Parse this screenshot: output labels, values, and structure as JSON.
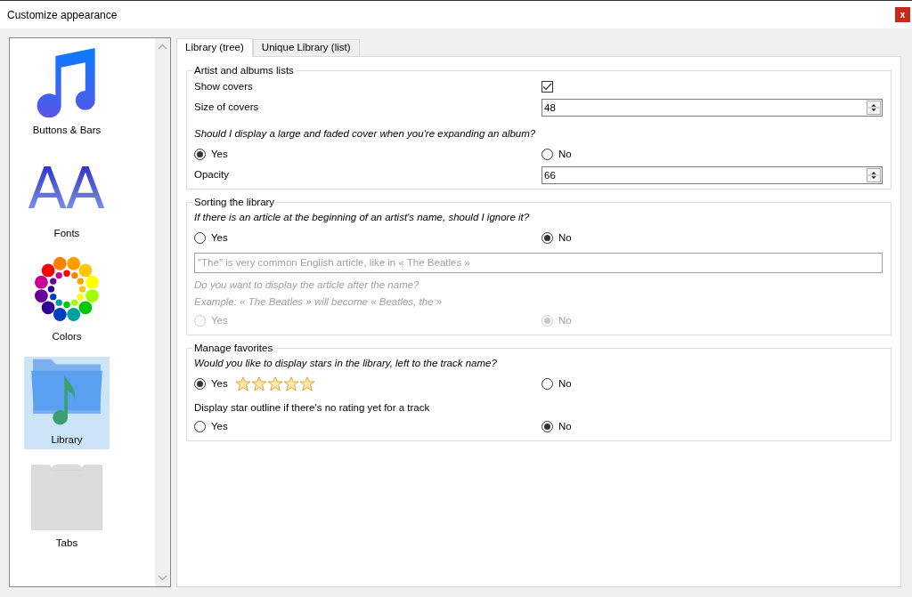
{
  "window": {
    "title": "Customize appearance",
    "close": "x"
  },
  "sidebar": {
    "items": [
      {
        "label": "Buttons & Bars",
        "kind": "note",
        "selected": false
      },
      {
        "label": "Fonts",
        "kind": "letters",
        "glyph": "AA",
        "selected": false
      },
      {
        "label": "Colors",
        "kind": "palette",
        "selected": false
      },
      {
        "label": "Library",
        "kind": "folder",
        "selected": true
      },
      {
        "label": "Tabs",
        "kind": "tabs",
        "selected": false
      }
    ]
  },
  "tabs": [
    {
      "label": "Library (tree)",
      "selected": true
    },
    {
      "label": "Unique Library (list)",
      "selected": false
    }
  ],
  "sections": [
    {
      "title": "Artist and albums lists",
      "rows": [
        {
          "kind": "checkbox",
          "label": "Show covers",
          "checked": true
        },
        {
          "kind": "spinner",
          "label": "Size of covers",
          "value": "48"
        },
        {
          "kind": "question",
          "text": "Should I display a large and faded cover when you're expanding an album?",
          "disabled": false
        },
        {
          "kind": "radios",
          "disabled": false,
          "options": [
            {
              "label": "Yes",
              "selected": true
            },
            {
              "label": "No",
              "selected": false
            }
          ]
        },
        {
          "kind": "spinner",
          "label": "Opacity",
          "value": "66"
        }
      ]
    },
    {
      "title": "Sorting the library",
      "rows": [
        {
          "kind": "question",
          "text": "If there is an article at the beginning of an artist's name, should I ignore it?",
          "disabled": false
        },
        {
          "kind": "radios",
          "disabled": false,
          "options": [
            {
              "label": "Yes",
              "selected": false
            },
            {
              "label": "No",
              "selected": true
            }
          ]
        },
        {
          "kind": "textfield",
          "placeholder": "\"The\" is very common English article, like in « The Beatles »"
        },
        {
          "kind": "question",
          "text": "Do you want to display the article after the name?",
          "disabled": true
        },
        {
          "kind": "question",
          "text": "Example:  « The Beatles » will become « Beatles, the »",
          "disabled": true
        },
        {
          "kind": "radios",
          "disabled": true,
          "options": [
            {
              "label": "Yes",
              "selected": false
            },
            {
              "label": "No",
              "selected": true
            }
          ]
        }
      ]
    },
    {
      "title": "Manage favorites",
      "rows": [
        {
          "kind": "question",
          "text": "Would you like to display stars in the library, left to the track name?",
          "disabled": false
        },
        {
          "kind": "radios",
          "disabled": false,
          "stars": 5,
          "options": [
            {
              "label": "Yes",
              "selected": true
            },
            {
              "label": "No",
              "selected": false
            }
          ]
        },
        {
          "kind": "label",
          "label": "Display star outline if there's no rating yet for a track"
        },
        {
          "kind": "radios",
          "disabled": false,
          "options": [
            {
              "label": "Yes",
              "selected": false
            },
            {
              "label": "No",
              "selected": true
            }
          ]
        }
      ]
    }
  ]
}
